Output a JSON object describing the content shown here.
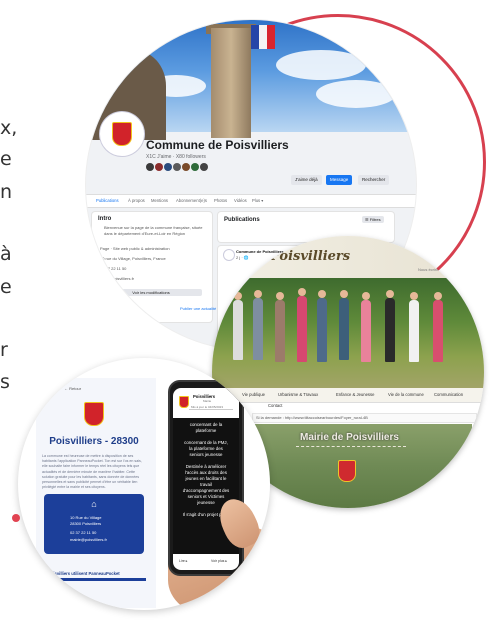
{
  "left_text": {
    "l1": "x,",
    "l2": "e",
    "l3": "n",
    "l4": "à",
    "l5": "e",
    "l6": "r",
    "l7": "s"
  },
  "facebook": {
    "page_title": "Commune de Poisvilliers",
    "subtitle": "X1C J'aime · X80 followers",
    "buttons": [
      "J'aime déjà",
      "Message",
      "Rechercher"
    ],
    "tabs": [
      "Publications",
      "À propos",
      "Mentions",
      "Abonnement(e)s",
      "Photos",
      "Vidéos",
      "Plus ▾"
    ],
    "intro": {
      "heading": "Intro",
      "text": "Bienvenue sur la page de la commune française, située dans le département d'Eure-et-Loir en Région",
      "rows": [
        "Page · Site web public & administration",
        "10 rue du Village, Poisvilliers, France",
        "02 37 22 11 50",
        "mairie.poisvilliers.fr"
      ],
      "button": "Voir les modifications",
      "link": "Publier une actualité"
    },
    "posts": {
      "heading": "Publications",
      "filter": "☰ Filtres",
      "post_author": "Commune de Poisvilliers",
      "post_time": "2 j · 🌐"
    }
  },
  "website": {
    "title": "Poisvilliers",
    "top_link": "Nous écrire",
    "nav": [
      "Vie publique",
      "Urbanisme & Travaux",
      "Enfance & Jeunesse",
      "Vie de la commune",
      "Communication"
    ],
    "nav2": "Contact",
    "banner": "Si la demande : http://www.tiltaccoisearbourdes/Foyer_rural-4B",
    "hero_title": "Mairie de Poisvilliers"
  },
  "app": {
    "back": "← Retour",
    "title": "Poisvilliers - 28300",
    "desc": "La commune est heureuse de mettre à disposition de ses habitants l'application PanneauPocket. Ton est sur l'os en sais, elle souhaite faire informer le temps réel les citoyens tels que actualités et de dernière minute de manière l'habiter. Cette solution gratuite pour les habitants, sans donnée de données personnelles et sans publicité permet d'être un véritable lien privilégié entre la mairie et ses citoyens.",
    "address1": "10 Rue du Village",
    "address2": "28300 Poisvilliers",
    "phone": "02 37 22 11 50",
    "email": "mairie@poisvilliers.fr",
    "footer": "Poisvilliers utilisent PanneauPocket",
    "phone_screen": {
      "name": "Poisvilliers",
      "sub": "Mairie",
      "date": "Mis à jour le 04/05/2023",
      "body": [
        "concernant de la",
        "plateforme",
        "",
        "concernant de la PMJ,",
        "la plateforme des",
        "seniors jeunesse",
        "",
        "Destinée à améliorer",
        "l'accès aux droits des",
        "jeunes en facilitant le",
        "travail",
        "d'accompagnement des",
        "seniors et Victimes",
        "jeunesse",
        "",
        "Il s'agit d'un projet porté"
      ],
      "footer_left": "Lire ▸",
      "footer_right": "Voir plus ▸"
    }
  },
  "colors": {
    "accent_red": "#d7404f",
    "fb_blue": "#1877f2",
    "app_navy": "#1c3f9a"
  }
}
